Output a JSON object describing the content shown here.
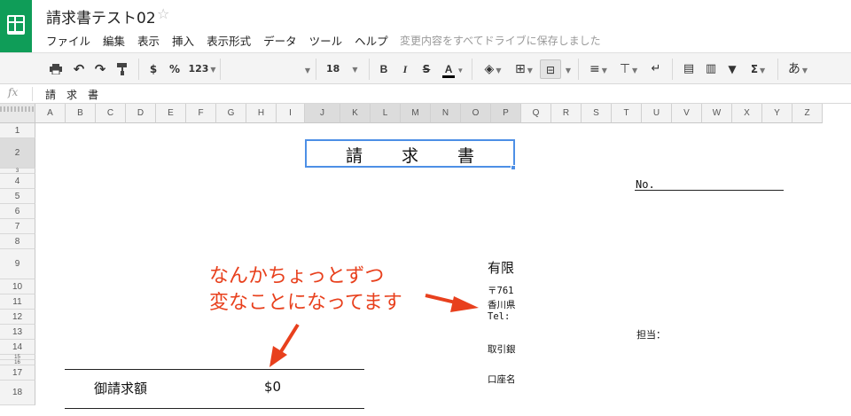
{
  "app": {
    "title": "請求書テスト02",
    "save_status": "変更内容をすべてドライブに保存しました",
    "menu": [
      "ファイル",
      "編集",
      "表示",
      "挿入",
      "表示形式",
      "データ",
      "ツール",
      "ヘルプ"
    ]
  },
  "toolbar": {
    "currency": "$",
    "percent": "%",
    "number_format": "123",
    "font_size": "18",
    "bold": "B",
    "italic": "I",
    "strikethrough": "S",
    "text_color": "A",
    "sum": "Σ",
    "input_tools": "あ",
    "text_color_hex": "#000000"
  },
  "formula_bar": {
    "fx": "fx",
    "value": "請　求　書"
  },
  "grid": {
    "columns": [
      "A",
      "B",
      "C",
      "D",
      "E",
      "F",
      "G",
      "H",
      "I",
      "J",
      "K",
      "L",
      "M",
      "N",
      "O",
      "P",
      "Q",
      "R",
      "S",
      "T",
      "U",
      "V",
      "W",
      "X",
      "Y",
      "Z"
    ],
    "rows": [
      "1",
      "2",
      "3",
      "4",
      "5",
      "6",
      "7",
      "8",
      "9",
      "10",
      "11",
      "12",
      "13",
      "14",
      "15",
      "16",
      "17",
      "18"
    ],
    "selected_columns": [
      "J",
      "K",
      "L",
      "M",
      "N",
      "O",
      "P"
    ],
    "selected_row": "2"
  },
  "sheet": {
    "title": "請求書",
    "no_label": "No.",
    "company": "有限",
    "address_lines": [
      "〒761",
      "香川県",
      "Tel:"
    ],
    "bank_label": "取引銀",
    "account_label": "口座名",
    "tanto_label": "担当：",
    "total_label": "御請求額",
    "total_value": "$0"
  },
  "annotation": {
    "text_line1": "なんかちょっとずつ",
    "text_line2": "変なことになってます",
    "color": "#e8401d"
  }
}
